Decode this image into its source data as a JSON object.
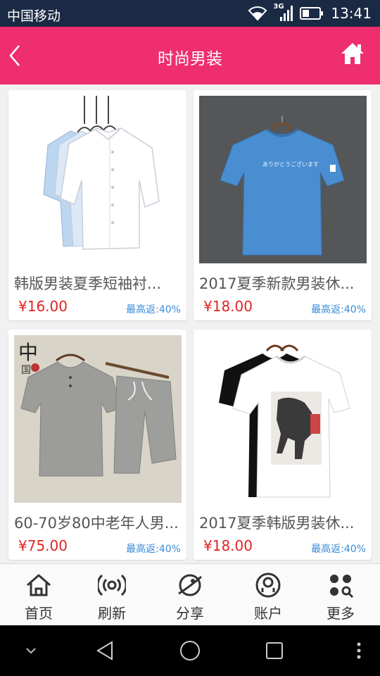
{
  "status_bar": {
    "carrier": "中国移动",
    "network": "3G",
    "time": "13:41"
  },
  "header": {
    "title": "时尚男装"
  },
  "products": [
    {
      "name": "韩版男装夏季短袖衬...",
      "price": "¥16.00",
      "rebate": "最高返:40%",
      "image": "white-linen-shirts"
    },
    {
      "name": "2017夏季新款男装休...",
      "price": "¥18.00",
      "rebate": "最高返:40%",
      "image": "blue-tshirt"
    },
    {
      "name": "60-70岁80中老年人男...",
      "price": "¥75.00",
      "rebate": "最高返:40%",
      "image": "grey-linen-set"
    },
    {
      "name": "2017夏季韩版男装休...",
      "price": "¥18.00",
      "rebate": "最高返:40%",
      "image": "horse-print-tshirts"
    }
  ],
  "tabbar": {
    "items": [
      {
        "label": "首页",
        "icon": "home-icon"
      },
      {
        "label": "刷新",
        "icon": "broadcast-icon"
      },
      {
        "label": "分享",
        "icon": "planet-icon"
      },
      {
        "label": "账户",
        "icon": "account-icon"
      },
      {
        "label": "更多",
        "icon": "more-grid-icon"
      }
    ]
  },
  "colors": {
    "header": "#ee2e6e",
    "price": "#e02424",
    "rebate": "#3a8ad6",
    "statusbar": "#1b2a44"
  }
}
